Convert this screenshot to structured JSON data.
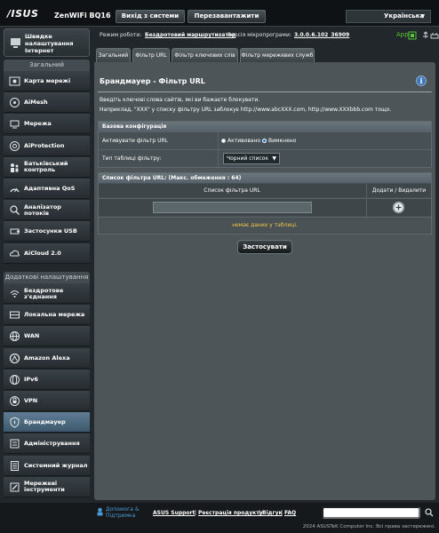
{
  "header": {
    "logo": "/ISUS",
    "model": "ZenWiFi BQ16",
    "logout_label": "Вихід з системи",
    "reboot_label": "Перезавантажити",
    "language": "Українська"
  },
  "status": {
    "mode_label": "Режим роботи:",
    "mode_value": "Бездротовий маршрутизатор",
    "firmware_label": "Версія мікропрограми:",
    "firmware_value": "3.0.0.6.102_36909",
    "app_label": "App"
  },
  "sidebar": {
    "quick_setup": "Швидке налаштування Інтернет",
    "general_head": "Загальний",
    "general_items": [
      {
        "label": "Карта мережі",
        "icon": "network-map-icon"
      },
      {
        "label": "AiMesh",
        "icon": "aimesh-icon"
      },
      {
        "label": "Мережа",
        "icon": "network-icon"
      },
      {
        "label": "AiProtection",
        "icon": "aiprotection-icon"
      },
      {
        "label": "Батьківський контроль",
        "icon": "parental-control-icon"
      },
      {
        "label": "Адаптивна QoS",
        "icon": "qos-icon"
      },
      {
        "label": "Аналізатор потоків",
        "icon": "traffic-analyzer-icon"
      },
      {
        "label": "Застосунки USB",
        "icon": "usb-icon"
      },
      {
        "label": "AiCloud 2.0",
        "icon": "aicloud-icon"
      }
    ],
    "advanced_head": "Додаткові налаштування",
    "advanced_items": [
      {
        "label": "Бездротове з'єднання",
        "icon": "wireless-icon"
      },
      {
        "label": "Локальна мережа",
        "icon": "lan-icon"
      },
      {
        "label": "WAN",
        "icon": "wan-icon"
      },
      {
        "label": "Amazon Alexa",
        "icon": "alexa-icon"
      },
      {
        "label": "IPv6",
        "icon": "ipv6-icon"
      },
      {
        "label": "VPN",
        "icon": "vpn-icon"
      },
      {
        "label": "Брандмауер",
        "icon": "firewall-icon",
        "active": true
      },
      {
        "label": "Адміністрування",
        "icon": "administration-icon"
      },
      {
        "label": "Системний журнал",
        "icon": "system-log-icon"
      },
      {
        "label": "Мережеві інструменти",
        "icon": "network-tools-icon"
      }
    ]
  },
  "tabs": [
    {
      "label": "Загальний"
    },
    {
      "label": "Фільтр URL",
      "active": true
    },
    {
      "label": "Фільтр ключових слів"
    },
    {
      "label": "Фільтр мережевих служб"
    }
  ],
  "main": {
    "title": "Брандмауер - Фільтр URL",
    "desc_1": "Введіть ключові слова сайтів, які ви бажаєте блокувати.",
    "desc_2": "Наприклад, \"XXX\" у списку фільтру URL заблокує http://www.abcXXX.com, http://www.XXXbbb.com тощо.",
    "basic_config": {
      "head": "Базова конфігурація",
      "enable_label": "Активувати фільтр URL",
      "option_on": "Активовано",
      "option_off": "Вимкнено",
      "selected": "off",
      "table_type_label": "Тип таблиці фільтру:",
      "table_type_value": "Чорний список"
    },
    "list": {
      "head": "Список фільтра URL: (Макс. обмеження : 64)",
      "col_url": "Список фільтра URL",
      "col_add": "Додати / Видалити",
      "input_value": "",
      "empty_text": "немає даних у таблиці."
    },
    "apply_label": "Застосувати"
  },
  "footer": {
    "help_support": "Допомога & Підтримка",
    "links": [
      "ASUS Support",
      "Реєстрація продукту",
      "Відгук",
      "FAQ"
    ],
    "copyright": "2024 ASUSTeK Computer Inc. Всі права застережені."
  },
  "colors": {
    "accent": "#1d74c9",
    "warning_text": "#f3c64a",
    "app_green": "#58c23a"
  }
}
